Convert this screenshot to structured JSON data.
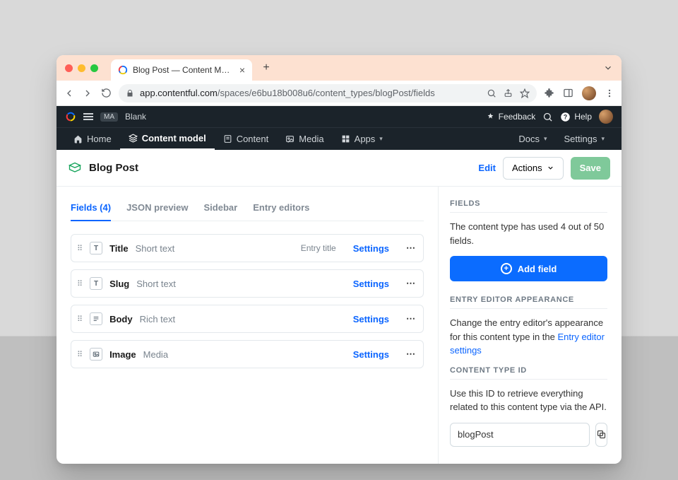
{
  "browser": {
    "tab_title": "Blog Post — Content Model —",
    "url_host": "app.contentful.com",
    "url_path": "/spaces/e6bu18b008u6/content_types/blogPost/fields"
  },
  "app_header": {
    "org_chip": "MA",
    "space_name": "Blank",
    "feedback": "Feedback",
    "help": "Help"
  },
  "nav": {
    "items": [
      "Home",
      "Content model",
      "Content",
      "Media",
      "Apps"
    ],
    "docs": "Docs",
    "settings": "Settings"
  },
  "page": {
    "title": "Blog Post",
    "edit": "Edit",
    "actions": "Actions",
    "save": "Save"
  },
  "tabs": {
    "fields": "Fields (4)",
    "json": "JSON preview",
    "sidebar": "Sidebar",
    "editors": "Entry editors"
  },
  "fields": [
    {
      "name": "Title",
      "type": "Short text",
      "extra": "Entry title",
      "icon": "T"
    },
    {
      "name": "Slug",
      "type": "Short text",
      "extra": "",
      "icon": "T"
    },
    {
      "name": "Body",
      "type": "Rich text",
      "extra": "",
      "icon": "rich"
    },
    {
      "name": "Image",
      "type": "Media",
      "extra": "",
      "icon": "media"
    }
  ],
  "field_row": {
    "settings": "Settings"
  },
  "side": {
    "fields_label": "FIELDS",
    "fields_desc": "The content type has used 4 out of 50 fields.",
    "add_field": "Add field",
    "appearance_label": "ENTRY EDITOR APPEARANCE",
    "appearance_desc_pre": "Change the entry editor's appearance for this content type in the ",
    "appearance_link": "Entry editor settings",
    "id_label": "CONTENT TYPE ID",
    "id_desc": "Use this ID to retrieve everything related to this content type via the API.",
    "id_value": "blogPost"
  }
}
